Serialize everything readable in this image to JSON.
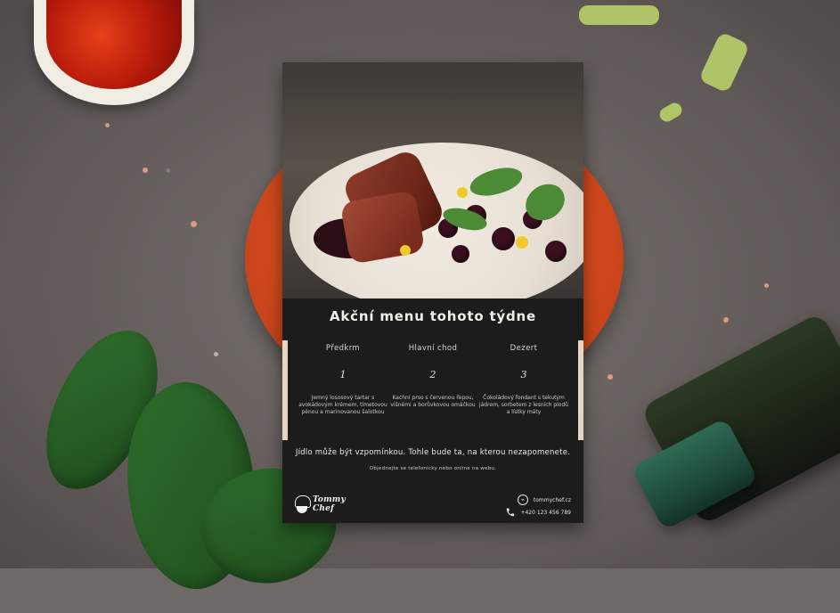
{
  "menu": {
    "title": "Akční menu tohoto týdne",
    "courses": [
      {
        "label": "Předkrm",
        "number": "1",
        "description": "Jemný lososový tartar s avokádovým krémem, tímetovou pěnou a marinovanou šalotkou"
      },
      {
        "label": "Hlavní chod",
        "number": "2",
        "description": "Kachní prso s červenou řepou, višněmi a borůvkovou omáčkou"
      },
      {
        "label": "Dezert",
        "number": "3",
        "description": "Čokoládový fondant s tekutým jádrem, sorbetem z lesních plodů a lístky máty"
      }
    ],
    "tagline": "Jídlo může být vzpomínkou. Tohle bude ta, na kterou nezapomenete.",
    "order_note": "Objednejte se telefonicky nebo online na webu.",
    "brand": {
      "line1": "Tommy",
      "line2": "Chef"
    },
    "contact": {
      "website": "tommychef.cz",
      "phone": "+420 123 456 789"
    }
  },
  "icons": {
    "globe": "globe-icon",
    "phone": "phone-icon",
    "logo": "chef-hat-icon"
  },
  "colors": {
    "menu_bg": "#1c1c1c",
    "accent_plate": "#d44a1e",
    "text_light": "#f1efe8",
    "edge_bar": "#e3d6c2"
  }
}
